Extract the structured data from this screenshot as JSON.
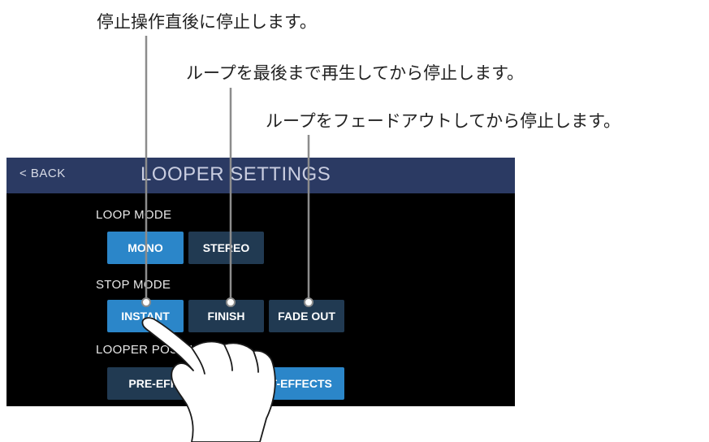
{
  "callouts": {
    "instant": "停止操作直後に停止します。",
    "finish": "ループを最後まで再生してから停止します。",
    "fade_out": "ループをフェードアウトしてから停止します。"
  },
  "header": {
    "back_label": "< BACK",
    "title": "LOOPER SETTINGS"
  },
  "loop_mode": {
    "label": "LOOP MODE",
    "options": [
      "MONO",
      "STEREO"
    ],
    "selected": "MONO"
  },
  "stop_mode": {
    "label": "STOP MODE",
    "options": [
      "INSTANT",
      "FINISH",
      "FADE OUT"
    ],
    "selected": "INSTANT"
  },
  "looper_position": {
    "label": "LOOPER POSITION",
    "options": [
      "PRE-EFFECTS",
      "POST-EFFECTS"
    ],
    "selected": "POST-EFFECTS"
  },
  "colors": {
    "titlebar": "#2b3a63",
    "selected_button": "#2b86c9",
    "unselected_button": "#213a52",
    "screen_background": "#000000"
  },
  "icons": [
    "pointing-hand-icon"
  ]
}
